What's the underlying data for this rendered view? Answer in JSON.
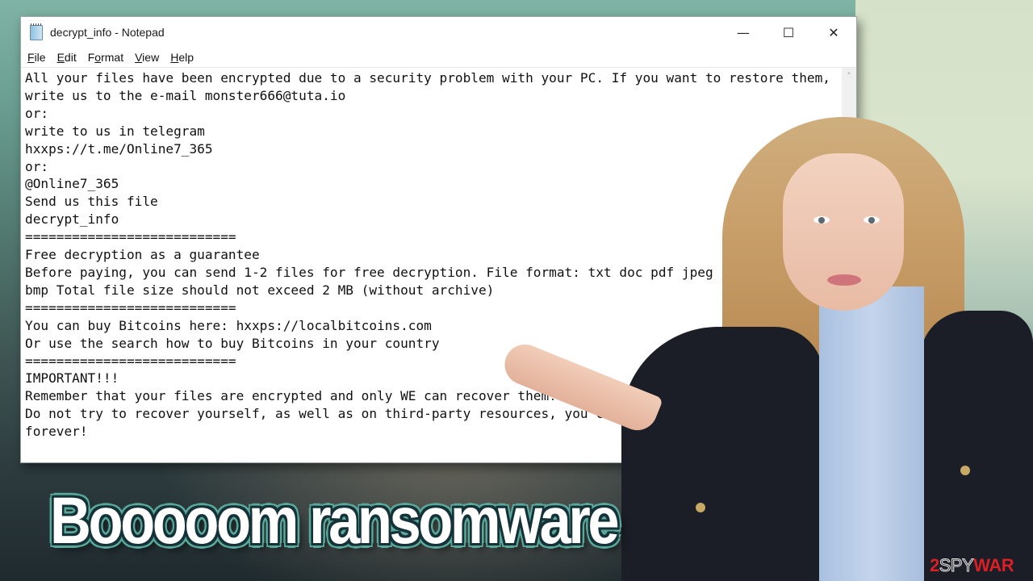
{
  "window": {
    "title": "decrypt_info - Notepad",
    "icon": "notepad-icon",
    "controls": {
      "minimize": "—",
      "maximize": "☐",
      "close": "✕"
    }
  },
  "menu": {
    "items": [
      {
        "accel": "F",
        "rest": "ile"
      },
      {
        "accel": "E",
        "rest": "dit"
      },
      {
        "pre": "F",
        "accel": "o",
        "rest": "rmat"
      },
      {
        "accel": "V",
        "rest": "iew"
      },
      {
        "accel": "H",
        "rest": "elp"
      }
    ]
  },
  "editor": {
    "lines": [
      "All your files have been encrypted due to a security problem with your PC. If you want to restore them,",
      "write us to the e-mail monster666@tuta.io",
      "or:",
      "write to us in telegram",
      "hxxps://t.me/Online7_365",
      "or:",
      "@Online7_365",
      "Send us this file",
      "decrypt_info",
      "===========================",
      "Free decryption as a guarantee",
      "Before paying, you can send 1-2 files for free decryption. File format: txt doc pdf jpeg jpg gif png",
      "bmp Total file size should not exceed 2 MB (without archive)",
      "===========================",
      "You can buy Bitcoins here: hxxps://localbitcoins.com",
      "Or use the search how to buy Bitcoins in your country",
      "===========================",
      "IMPORTANT!!!",
      "Remember that your files are encrypted and only WE can recover them!",
      "Do not try to recover yourself, as well as on third-party resources, you can lose your files",
      "forever!"
    ],
    "scroll_up_icon": "˄"
  },
  "headline": "Booooom ransomware",
  "watermark": {
    "part1": "2",
    "part2": "SPY",
    "part3": "WAR"
  },
  "colors": {
    "headline_outline": "#5aa89a",
    "watermark_red": "#d91f26"
  }
}
